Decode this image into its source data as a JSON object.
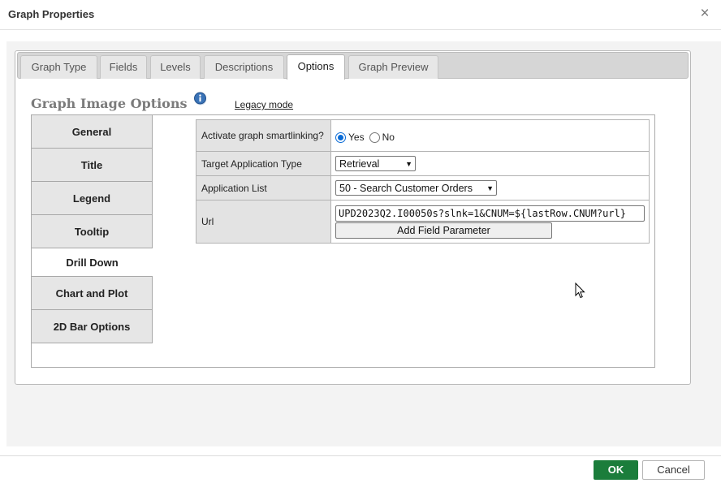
{
  "dialog": {
    "title": "Graph Properties",
    "close_glyph": "×"
  },
  "tabs": [
    {
      "label": "Graph Type"
    },
    {
      "label": "Fields"
    },
    {
      "label": "Levels"
    },
    {
      "label": "Descriptions"
    },
    {
      "label": "Options",
      "active": true
    },
    {
      "label": "Graph Preview"
    }
  ],
  "section": {
    "title": "Graph Image Options",
    "info_icon": "info-icon",
    "legacy_link": "Legacy mode"
  },
  "sidebar": {
    "items": [
      {
        "label": "General"
      },
      {
        "label": "Title"
      },
      {
        "label": "Legend"
      },
      {
        "label": "Tooltip"
      },
      {
        "label": "Drill Down",
        "active": true
      },
      {
        "label": "Chart and Plot"
      },
      {
        "label": "2D Bar Options"
      }
    ]
  },
  "form": {
    "smartlinking": {
      "label": "Activate graph smartlinking?",
      "options": [
        "Yes",
        "No"
      ],
      "selected": "Yes"
    },
    "target_type": {
      "label": "Target Application Type",
      "value": "Retrieval"
    },
    "app_list": {
      "label": "Application List",
      "value": "50 - Search Customer Orders"
    },
    "url": {
      "label": "Url",
      "value": "UPD2023Q2.I00050s?slnk=1&CNUM=${lastRow.CNUM?url}",
      "add_param_label": "Add Field Parameter"
    }
  },
  "footer": {
    "ok_label": "OK",
    "cancel_label": "Cancel"
  },
  "colors": {
    "ok_button": "#1b7d3b",
    "radio_checked": "#0a6bd6",
    "section_title": "#7b7b7b"
  }
}
